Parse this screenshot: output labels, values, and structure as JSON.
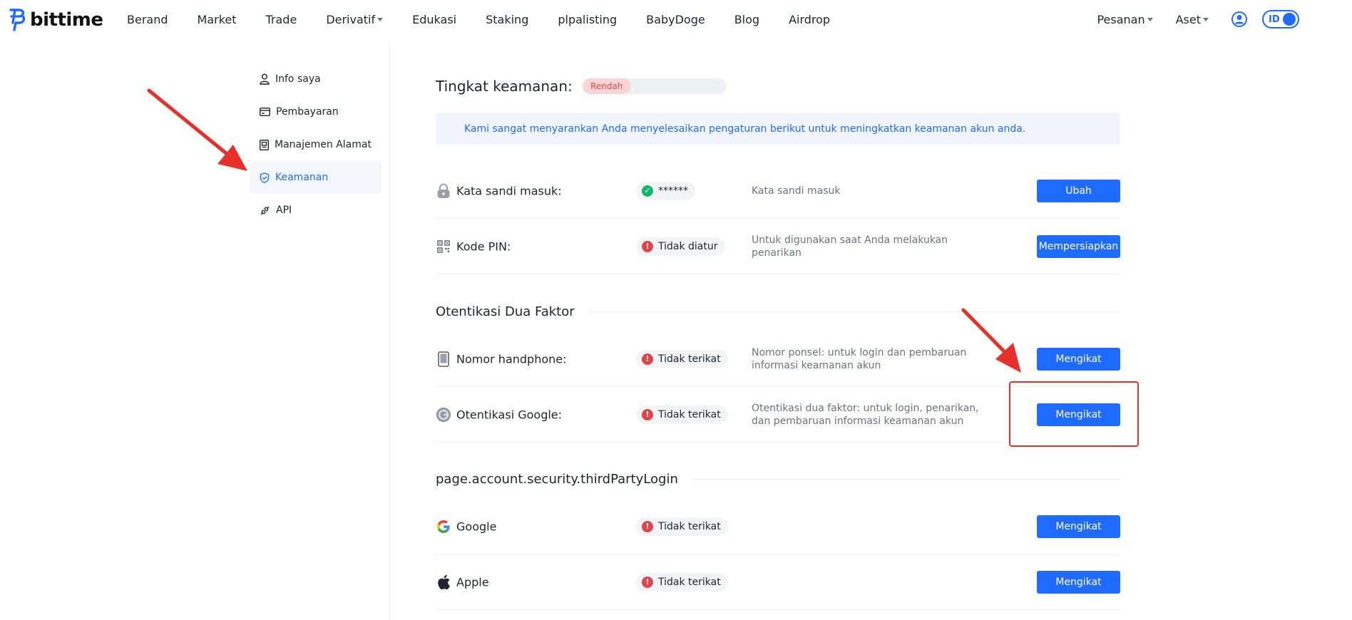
{
  "header": {
    "brand": "bittime",
    "nav": [
      {
        "label": "Berand",
        "caret": false
      },
      {
        "label": "Market",
        "caret": false
      },
      {
        "label": "Trade",
        "caret": false
      },
      {
        "label": "Derivatif",
        "caret": true
      },
      {
        "label": "Edukasi",
        "caret": false
      },
      {
        "label": "Staking",
        "caret": false
      },
      {
        "label": "plpalisting",
        "caret": false
      },
      {
        "label": "BabyDoge",
        "caret": false
      },
      {
        "label": "Blog",
        "caret": false
      },
      {
        "label": "Airdrop",
        "caret": false
      }
    ],
    "orders_label": "Pesanan",
    "assets_label": "Aset",
    "lang_label": "ID"
  },
  "sidebar": {
    "items": [
      {
        "label": "Info saya",
        "icon": "user-icon",
        "active": false
      },
      {
        "label": "Pembayaran",
        "icon": "card-icon",
        "active": false
      },
      {
        "label": "Manajemen Alamat",
        "icon": "address-book-icon",
        "active": false
      },
      {
        "label": "Keamanan",
        "icon": "shield-icon",
        "active": true
      },
      {
        "label": "API",
        "icon": "link-icon",
        "active": false
      }
    ]
  },
  "security": {
    "level_title": "Tingkat keamanan:",
    "level_badge": "Rendah",
    "notice": "Kami sangat menyarankan Anda menyelesaikan pengaturan berikut untuk meningkatkan keamanan akun anda.",
    "basic": [
      {
        "label": "Kata sandi masuk:",
        "icon": "lock-icon",
        "status": "******",
        "status_type": "ok",
        "desc": "Kata sandi masuk",
        "button": "Ubah"
      },
      {
        "label": "Kode PIN:",
        "icon": "qr-code-icon",
        "status": "Tidak diatur",
        "status_type": "err",
        "desc": "Untuk digunakan saat Anda melakukan penarikan",
        "button": "Mempersiapkan"
      }
    ],
    "two_factor_title": "Otentikasi Dua Faktor",
    "two_factor": [
      {
        "label": "Nomor handphone:",
        "icon": "phone-icon",
        "status": "Tidak terikat",
        "status_type": "err",
        "desc": "Nomor ponsel: untuk login dan pembaruan informasi keamanan akun",
        "button": "Mengikat"
      },
      {
        "label": "Otentikasi Google:",
        "icon": "google-authenticator-icon",
        "status": "Tidak terikat",
        "status_type": "err",
        "desc": "Otentikasi dua faktor: untuk login, penarikan, dan pembaruan informasi keamanan akun",
        "button": "Mengikat"
      }
    ],
    "third_party_title": "page.account.security.thirdPartyLogin",
    "third_party": [
      {
        "label": "Google",
        "icon": "google-icon",
        "status": "Tidak terikat",
        "status_type": "err",
        "desc": "",
        "button": "Mengikat"
      },
      {
        "label": "Apple",
        "icon": "apple-icon",
        "status": "Tidak terikat",
        "status_type": "err",
        "desc": "",
        "button": "Mengikat"
      }
    ]
  },
  "colors": {
    "accent": "#1f6bff",
    "danger": "#e0454b",
    "success": "#12b76a",
    "annotation": "#e8302a"
  }
}
